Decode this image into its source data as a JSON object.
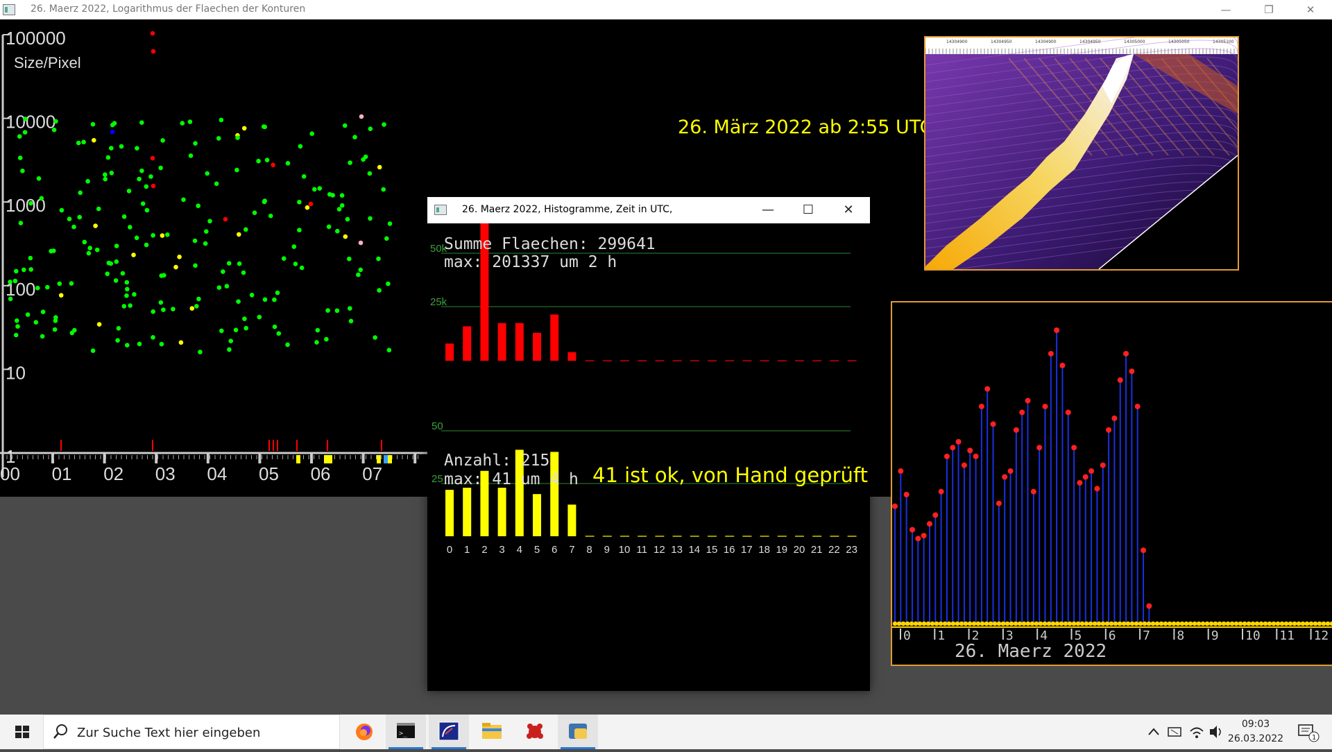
{
  "main_window": {
    "title": "26. Maerz 2022, Logarithmus der Flaechen der Konturen",
    "y_axis_caption": "Size/Pixel",
    "y_ticks": [
      "100000",
      "10000",
      "1000",
      "100",
      "10",
      "1"
    ],
    "x_ticks": [
      "00",
      "01",
      "02",
      "03",
      "04",
      "05",
      "06",
      "07"
    ],
    "point_colors": {
      "normal": "#00ff00",
      "medium": "#ffff00",
      "large": "#ff0000",
      "other_blue": "#0000ff",
      "other_pink": "#ffb0c0"
    }
  },
  "overlay_text": {
    "timestamp_caption": "26. März 2022 ab 2:55 UTC",
    "manual_check_note": "41 ist ok, von Hand geprüft"
  },
  "spectrogram_panel": {
    "freq_labels": [
      "14304900",
      "14304950",
      "14304900",
      "14304950",
      "14305000",
      "14305050",
      "14305100"
    ]
  },
  "hourly_plot": {
    "date_label": "26. Maerz 2022",
    "x_ticks": [
      "0",
      "1",
      "2",
      "3",
      "4",
      "5",
      "6",
      "7",
      "8",
      "9",
      "10",
      "11",
      "12"
    ]
  },
  "histogram_window": {
    "title": "26. Maerz 2022, Histogramme, Zeit in UTC,",
    "sum_label": "Summe Flaechen: 299641",
    "max_area_label": "max: 201337 um 2 h",
    "count_label": "Anzahl: 215",
    "max_count_label": "max: 41 um 4 h",
    "area_grid_labels": [
      "50k",
      "25k"
    ],
    "count_grid_labels": [
      "50",
      "25"
    ],
    "hour_labels": [
      "0",
      "1",
      "2",
      "3",
      "4",
      "5",
      "6",
      "7",
      "8",
      "9",
      "10",
      "11",
      "12",
      "13",
      "14",
      "15",
      "16",
      "17",
      "18",
      "19",
      "20",
      "21",
      "22",
      "23"
    ],
    "area_bar_color": "#ff0000",
    "count_bar_color": "#ffff00"
  },
  "chart_data": [
    {
      "type": "bar",
      "title": "Summe Flaechen: 299641",
      "categories": [
        "0",
        "1",
        "2",
        "3",
        "4",
        "5",
        "6",
        "7",
        "8",
        "9",
        "10",
        "11",
        "12",
        "13",
        "14",
        "15",
        "16",
        "17",
        "18",
        "19",
        "20",
        "21",
        "22",
        "23"
      ],
      "series": [
        {
          "values": [
            8000,
            16000,
            201337,
            17500,
            17500,
            13000,
            21500,
            4000,
            0,
            0,
            0,
            0,
            0,
            0,
            0,
            0,
            0,
            0,
            0,
            0,
            0,
            0,
            0,
            0
          ]
        }
      ],
      "grid_values": [
        25000,
        50000
      ],
      "ylim": [
        0,
        50000
      ]
    },
    {
      "type": "bar",
      "title": "Anzahl: 215",
      "categories": [
        "0",
        "1",
        "2",
        "3",
        "4",
        "5",
        "6",
        "7",
        "8",
        "9",
        "10",
        "11",
        "12",
        "13",
        "14",
        "15",
        "16",
        "17",
        "18",
        "19",
        "20",
        "21",
        "22",
        "23"
      ],
      "series": [
        {
          "values": [
            22,
            23,
            31,
            23,
            41,
            20,
            40,
            15,
            0,
            0,
            0,
            0,
            0,
            0,
            0,
            0,
            0,
            0,
            0,
            0,
            0,
            0,
            0,
            0
          ]
        }
      ],
      "grid_values": [
        25,
        50
      ],
      "ylim": [
        0,
        55
      ]
    },
    {
      "type": "scatter",
      "xlabel": "",
      "ylabel": "Size/Pixel",
      "yscale": "log",
      "ylim": [
        1,
        100000
      ],
      "xlim": [
        0,
        7.5
      ],
      "note": "log-scale scatter of contour sizes; approx. 215 points between hour 0 and 7.5"
    },
    {
      "type": "line",
      "title": "26. Maerz 2022",
      "x_unit": "hour",
      "x_range": [
        0,
        12.5
      ],
      "values": [
        40,
        52,
        44,
        32,
        29,
        30,
        34,
        37,
        45,
        57,
        60,
        62,
        54,
        59,
        57,
        74,
        80,
        68,
        41,
        50,
        52,
        66,
        72,
        76,
        45,
        60,
        74,
        92,
        100,
        88,
        72,
        60,
        48,
        50,
        52,
        46,
        54,
        66,
        70,
        83,
        92,
        86,
        74,
        25,
        6,
        0,
        0,
        0,
        0,
        0
      ]
    }
  ]
}
